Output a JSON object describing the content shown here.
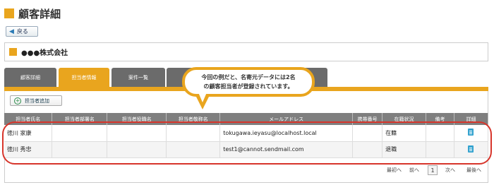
{
  "page": {
    "title": "顧客詳細"
  },
  "toolbar": {
    "back_label": "戻る"
  },
  "company": {
    "name": "●●●株式会社"
  },
  "tabs": [
    {
      "label": "顧客詳細"
    },
    {
      "label": "担当者情報"
    },
    {
      "label": "案件一覧"
    }
  ],
  "add_button": {
    "label": "担当者追加"
  },
  "table": {
    "columns": [
      "担当者氏名",
      "担当者部署名",
      "担当者役職名",
      "担当者敬称名",
      "メールアドレス",
      "携帯番号",
      "在籍状況",
      "備考",
      "詳細"
    ],
    "rows": [
      {
        "name": "徳川 家康",
        "email": "tokugawa.ieyasu@localhost.local",
        "status": "在籍"
      },
      {
        "name": "徳川 秀忠",
        "email": "test1@cannot.sendmail.com",
        "status": "退職"
      }
    ]
  },
  "pager": {
    "first": "最初へ",
    "prev": "前へ",
    "page": "1",
    "next": "次へ",
    "last": "最後へ"
  },
  "callout": {
    "line1": "今回の例だと、名寄元データには2名",
    "line2": "の顧客担当者が登録されています。"
  },
  "colors": {
    "accent": "#e9a51e",
    "tab_inactive": "#6b6b6b",
    "highlight": "#d7352b",
    "doc_icon": "#35a3cf"
  }
}
